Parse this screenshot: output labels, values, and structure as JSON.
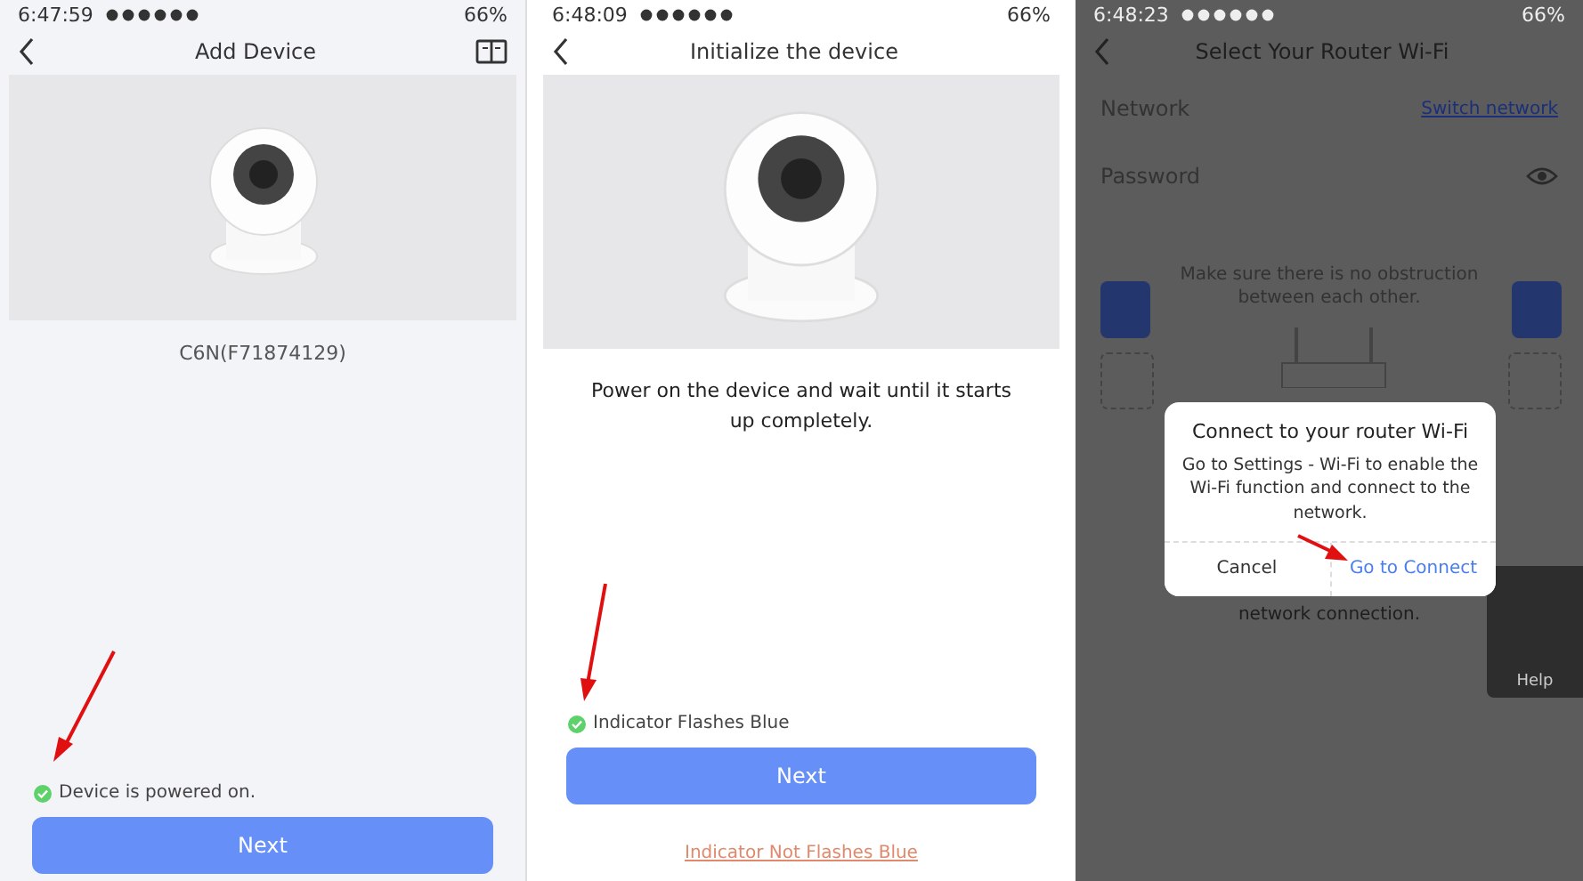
{
  "add_device": {
    "status_bar": {
      "time": "6:47:59",
      "battery": "66%"
    },
    "title": "Add Device",
    "model": "C6N(F71874129)",
    "check": {
      "label": "Device is powered on.",
      "checked": true
    },
    "button": "Next"
  },
  "initialize": {
    "status_bar": {
      "time": "6:48:09",
      "battery": "66%"
    },
    "title": "Initialize the device",
    "instruction": "Power on the device and wait until it starts up completely.",
    "check": {
      "label": "Indicator Flashes Blue",
      "checked": true
    },
    "button": "Next",
    "link": "Indicator Not Flashes Blue"
  },
  "router_wifi": {
    "status_bar": {
      "time": "6:48:23",
      "battery": "66%"
    },
    "title": "Select Your Router Wi-Fi",
    "network_label": "Network",
    "switch_link": "Switch network",
    "password_label": "Password",
    "tip_top": "Make sure there is no obstruction between each other.",
    "tip_bottom": "network connection.",
    "help": "Help",
    "dialog": {
      "title": "Connect to your router Wi-Fi",
      "message": "Go to Settings - Wi-Fi to enable the Wi-Fi function and connect to the network.",
      "buttons": [
        {
          "label": "Cancel",
          "primary": false
        },
        {
          "label": "Go to Connect",
          "primary": true
        }
      ]
    }
  }
}
